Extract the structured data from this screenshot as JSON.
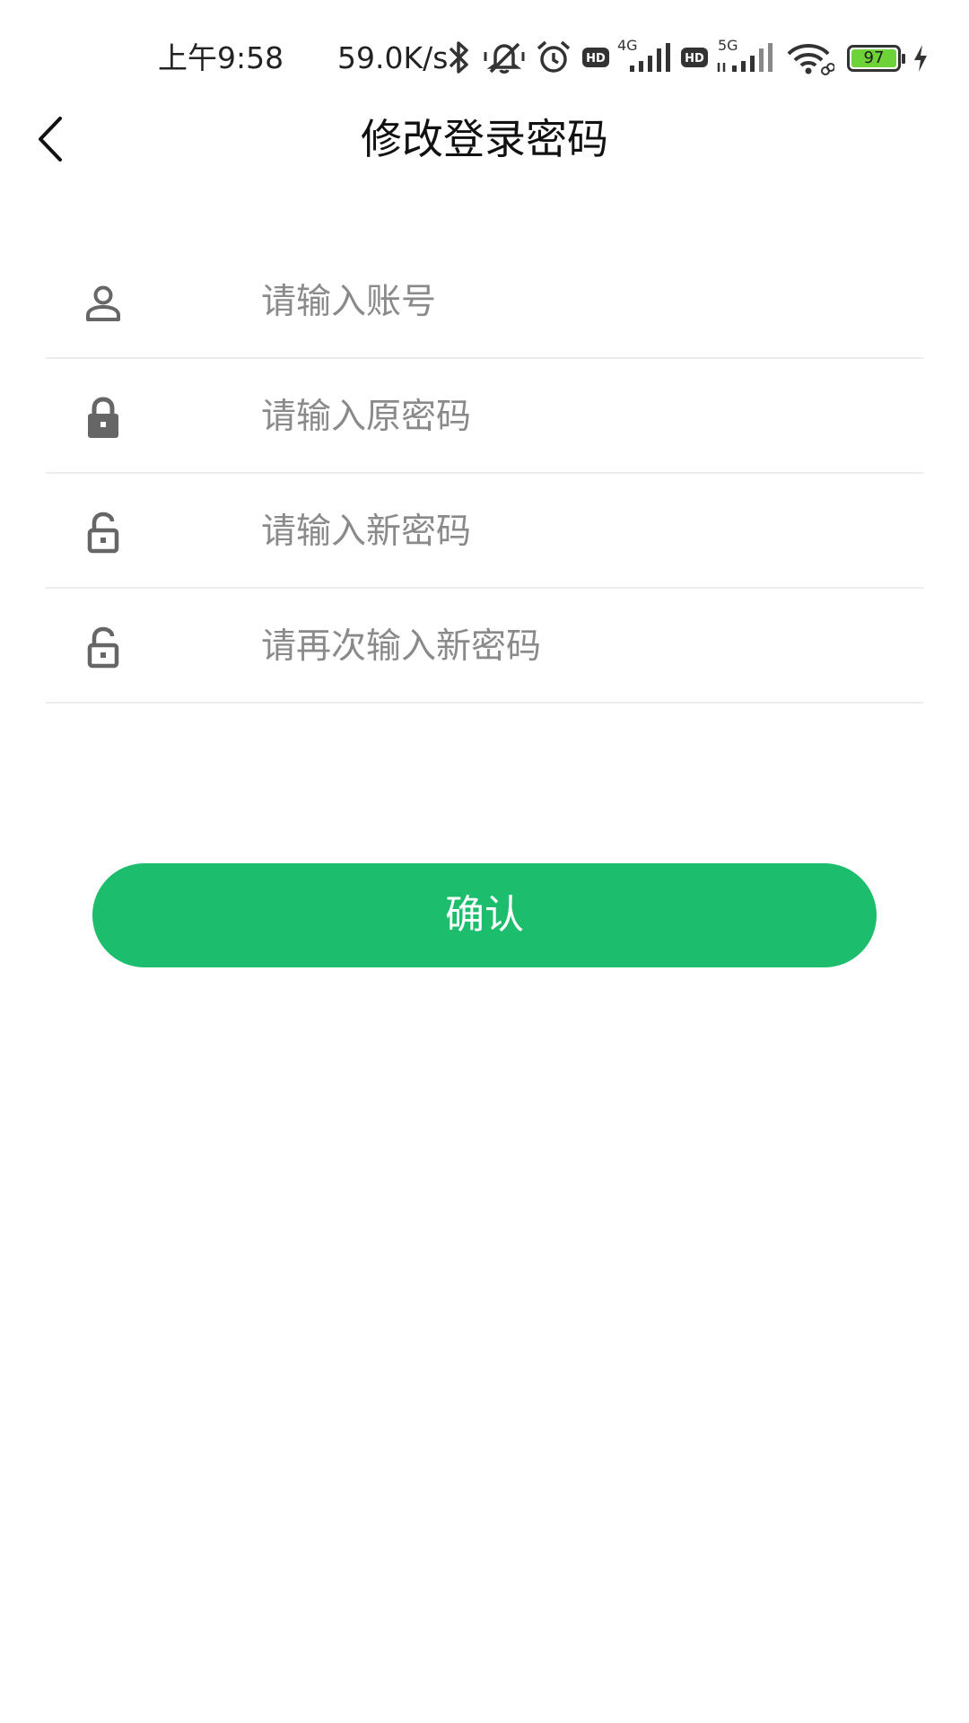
{
  "status_bar": {
    "time": "上午9:58",
    "network_speed": "59.0K/s",
    "icons": [
      "bluetooth-icon",
      "mute-icon",
      "alarm-icon",
      "hd-icon",
      "signal-4g-icon",
      "hd-icon",
      "signal-5g-icon",
      "wifi-icon",
      "battery-icon",
      "charging-icon"
    ],
    "signal_4g_label": "4G",
    "signal_5g_label": "5G",
    "hd_label": "HD",
    "battery_level": "97",
    "battery_color": "#6ed336"
  },
  "header": {
    "title": "修改登录密码",
    "back_icon": "chevron-left-icon"
  },
  "form": {
    "fields": [
      {
        "icon": "user-icon",
        "placeholder": "请输入账号",
        "value": ""
      },
      {
        "icon": "lock-icon",
        "placeholder": "请输入原密码",
        "value": ""
      },
      {
        "icon": "unlock-icon",
        "placeholder": "请输入新密码",
        "value": ""
      },
      {
        "icon": "unlock-icon",
        "placeholder": "请再次输入新密码",
        "value": ""
      }
    ]
  },
  "confirm": {
    "label": "确认",
    "color": "#1cbe6d"
  }
}
